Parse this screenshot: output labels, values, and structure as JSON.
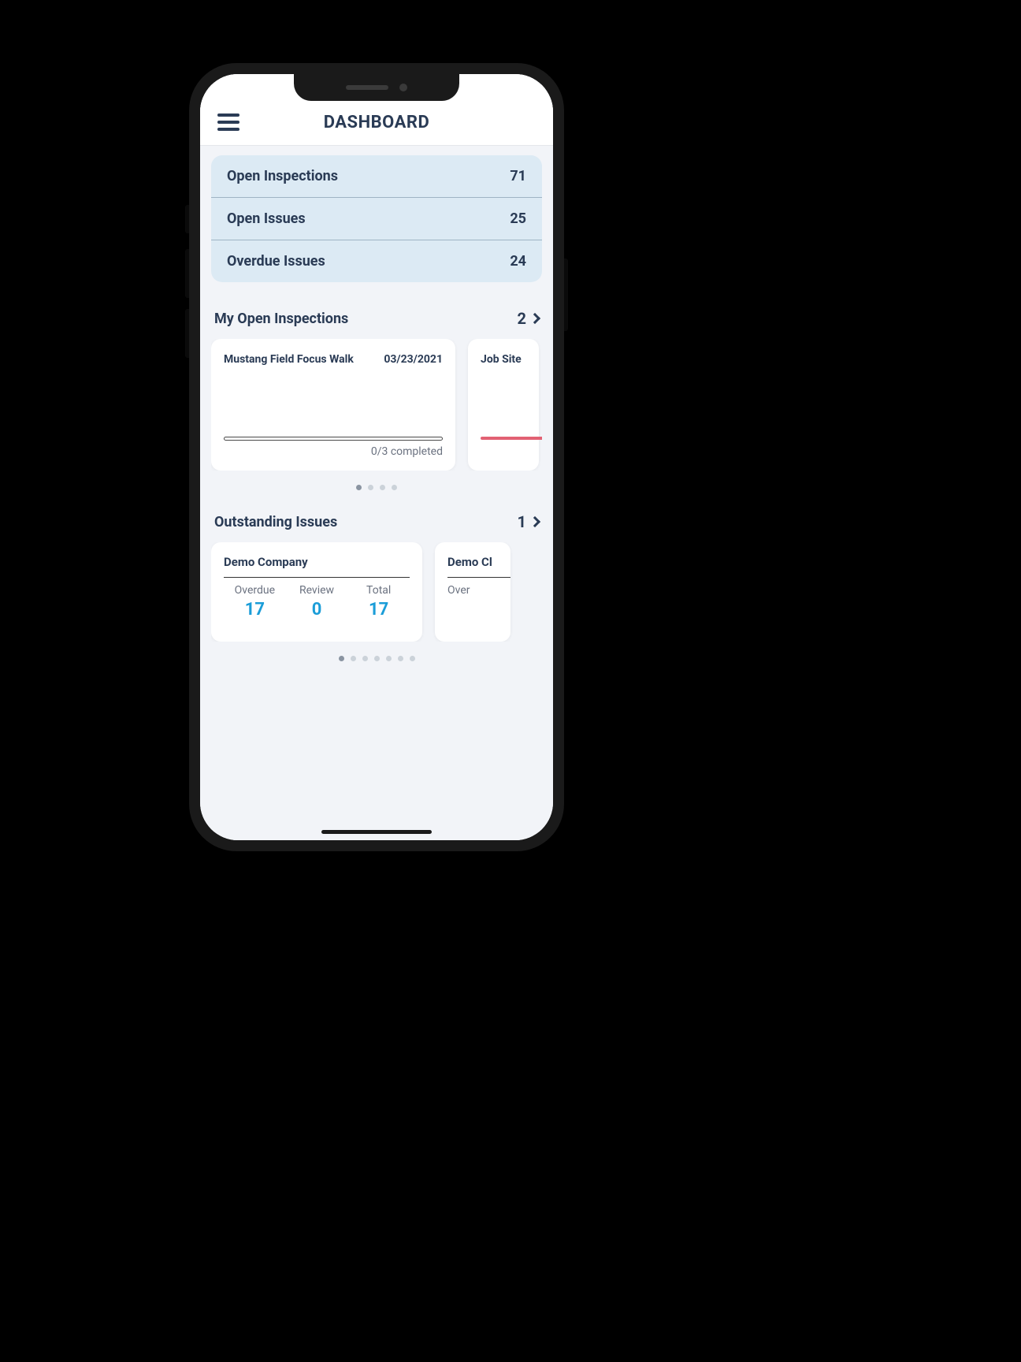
{
  "header": {
    "title": "DASHBOARD"
  },
  "stats": [
    {
      "label": "Open Inspections",
      "value": "71"
    },
    {
      "label": "Open Issues",
      "value": "25"
    },
    {
      "label": "Overdue Issues",
      "value": "24"
    }
  ],
  "my_open_inspections": {
    "title": "My Open Inspections",
    "count": "2",
    "cards": [
      {
        "name": "Mustang Field Focus Walk",
        "date": "03/23/2021",
        "progress_text": "0/3 completed"
      },
      {
        "name": "Job Site"
      }
    ],
    "pager_total": 4,
    "pager_active": 0
  },
  "outstanding_issues": {
    "title": "Outstanding Issues",
    "count": "1",
    "cards": [
      {
        "company": "Demo Company",
        "cols": [
          {
            "label": "Overdue",
            "value": "17"
          },
          {
            "label": "Review",
            "value": "0"
          },
          {
            "label": "Total",
            "value": "17"
          }
        ]
      },
      {
        "company": "Demo Cl",
        "cols": [
          {
            "label": "Over",
            "value": ""
          }
        ]
      }
    ],
    "pager_total": 7,
    "pager_active": 0
  }
}
